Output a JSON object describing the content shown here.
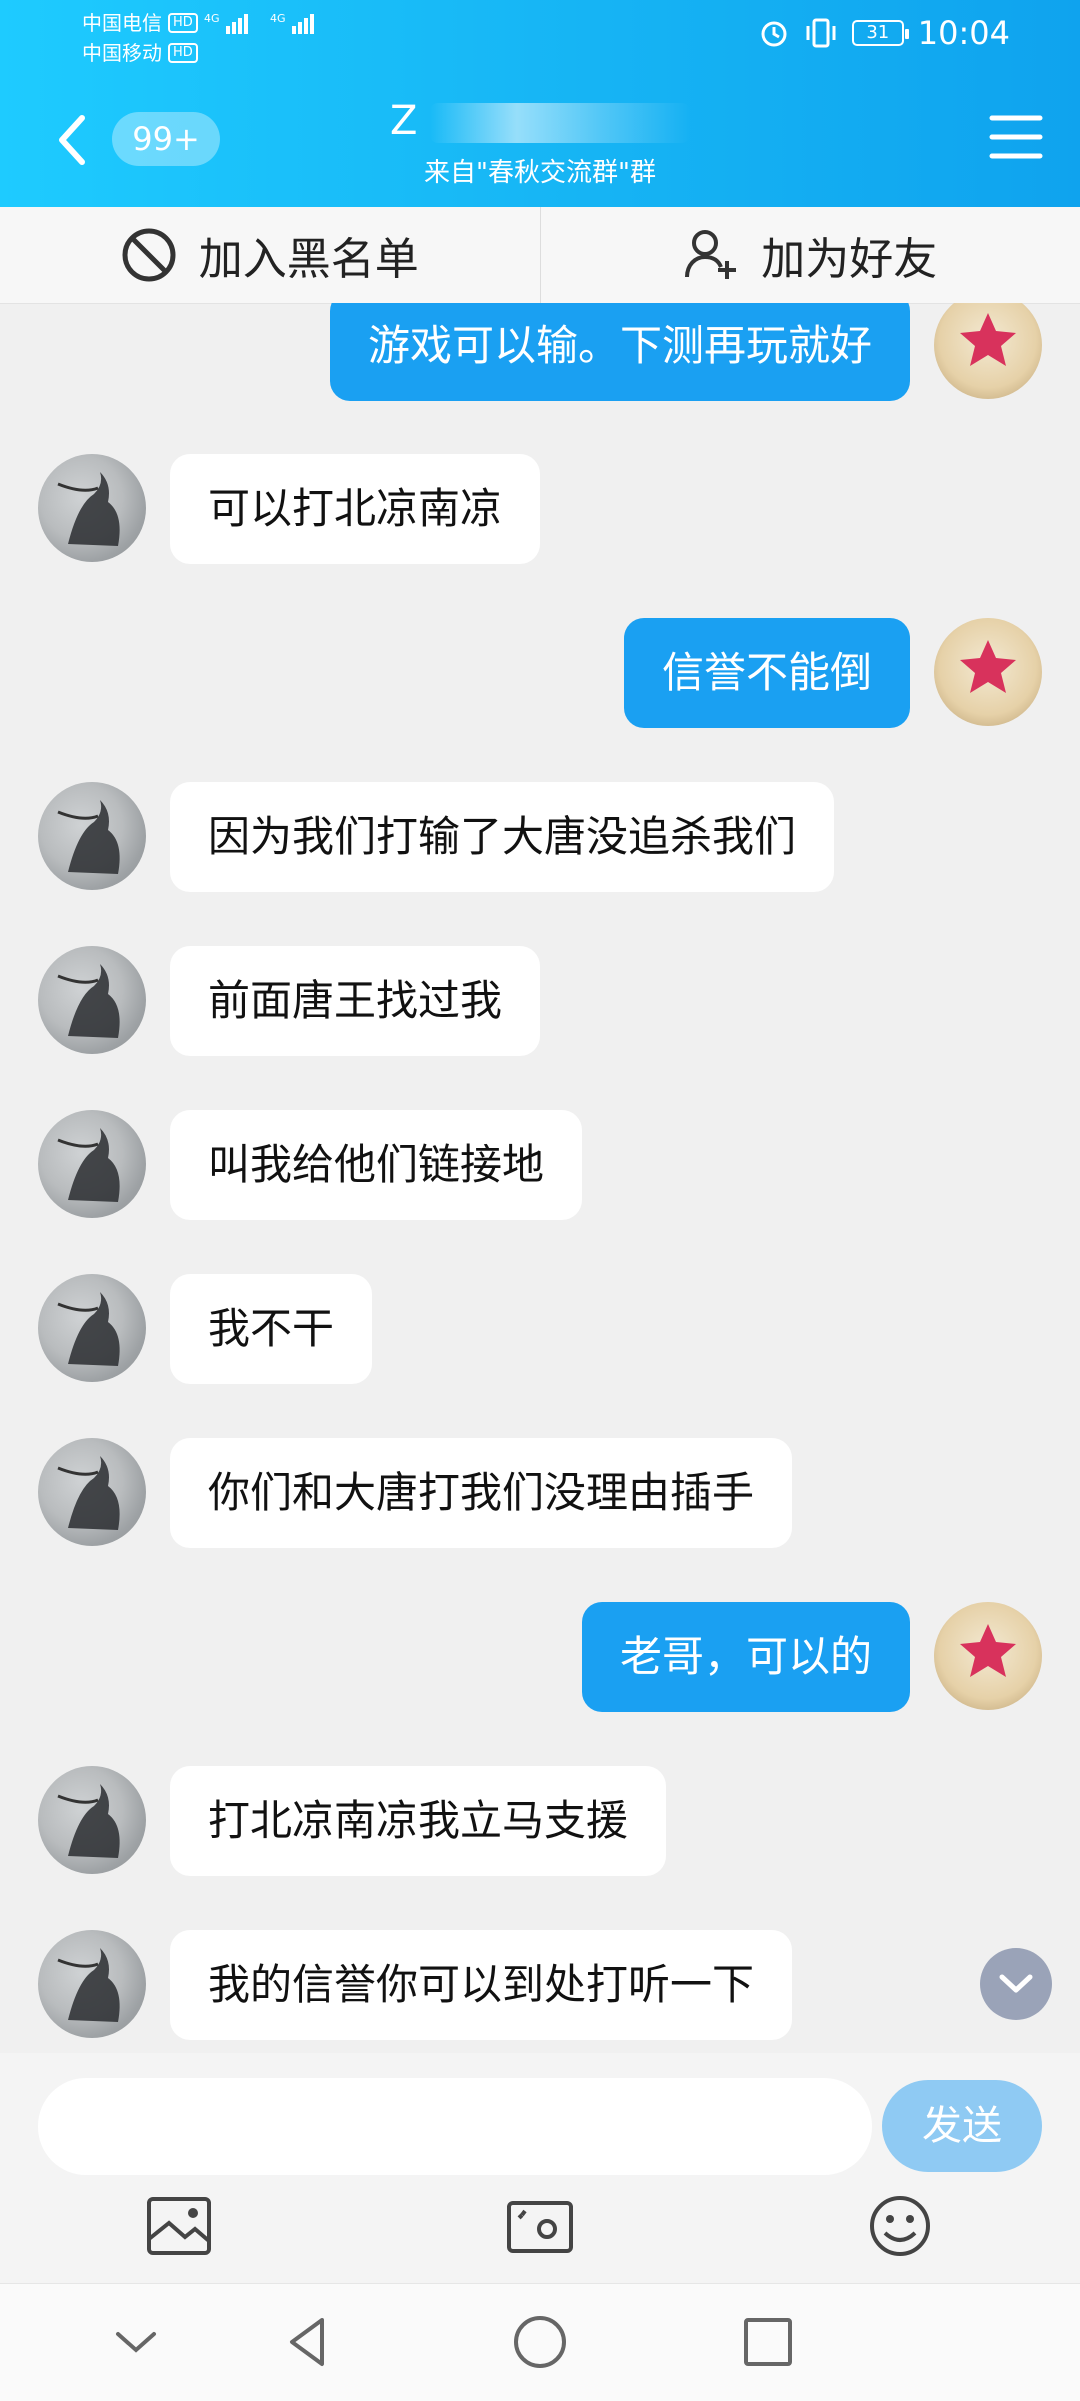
{
  "status_bar": {
    "carrier1": "中国电信",
    "carrier2": "中国移动",
    "hd": "HD",
    "net": "4G",
    "battery": "31",
    "time": "10:04"
  },
  "header": {
    "badge": "99+",
    "title": "Z",
    "subtitle": "来自\"春秋交流群\"群"
  },
  "actions": {
    "block": "加入黑名单",
    "add_friend": "加为好友"
  },
  "messages": [
    {
      "side": "right",
      "text": "游戏可以输。下测再玩就好"
    },
    {
      "side": "left",
      "text": "可以打北凉南凉"
    },
    {
      "side": "right",
      "text": "信誉不能倒"
    },
    {
      "side": "left",
      "text": "因为我们打输了大唐没追杀我们"
    },
    {
      "side": "left",
      "text": "前面唐王找过我"
    },
    {
      "side": "left",
      "text": "叫我给他们链接地"
    },
    {
      "side": "left",
      "text": "我不干"
    },
    {
      "side": "left",
      "text": "你们和大唐打我们没理由插手"
    },
    {
      "side": "right",
      "text": "老哥，可以的"
    },
    {
      "side": "left",
      "text": "打北凉南凉我立马支援"
    },
    {
      "side": "left",
      "text": "我的信誉你可以到处打听一下"
    }
  ],
  "input": {
    "value": "",
    "send": "发送"
  },
  "colors": {
    "header_start": "#1ecbff",
    "header_end": "#0fa3ee",
    "self_bubble": "#1aa0f2",
    "send_button": "#8fcaf3"
  },
  "icons": [
    "back-icon",
    "menu-icon",
    "block-icon",
    "add-friend-icon",
    "image-icon",
    "camera-icon",
    "emoji-icon",
    "scroll-down-icon",
    "nav-back-icon",
    "nav-home-icon",
    "nav-recents-icon",
    "nav-collapse-icon"
  ]
}
